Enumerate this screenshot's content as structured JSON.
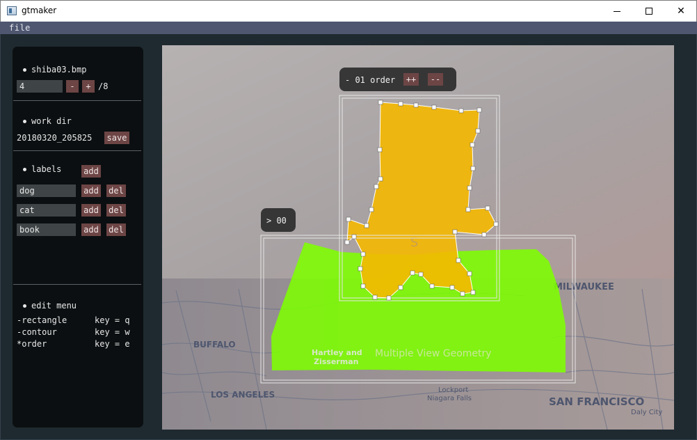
{
  "window": {
    "title": "gtmaker"
  },
  "menu": {
    "file": "file"
  },
  "panel": {
    "image": {
      "filename": "shiba03.bmp",
      "index": "4",
      "minus": "-",
      "plus": "+",
      "total": "/8"
    },
    "workdir": {
      "heading": "work dir",
      "value": "20180320_205825",
      "save": "save"
    },
    "labels": {
      "heading": "labels",
      "add": "add",
      "items": [
        {
          "name": "dog",
          "add": "add",
          "del": "del"
        },
        {
          "name": "cat",
          "add": "add",
          "del": "del"
        },
        {
          "name": "book",
          "add": "add",
          "del": "del"
        }
      ]
    },
    "edit_menu": {
      "heading": "edit menu",
      "items": [
        {
          "action": "-rectangle",
          "key": "key = q"
        },
        {
          "action": "-contour",
          "key": "key = w"
        },
        {
          "action": "*order",
          "key": "key = e"
        }
      ]
    }
  },
  "canvas": {
    "order_tag": {
      "label": "- 01 order",
      "inc": "++",
      "dec": "--"
    },
    "item_tag": {
      "label": "> 00"
    },
    "photo_text": {
      "book_authors_1": "Hartley and",
      "book_authors_2": "Zisserman",
      "book_title": "Multiple View Geometry",
      "map_milwaukee": "MILWAUKEE",
      "map_buffalo": "BUFFALO",
      "map_san_francisco": "SAN FRANCISCO",
      "map_los_angeles": "LOS ANGELES",
      "map_niagara": "Niagara Falls",
      "map_lockport": "Lockport",
      "map_daly": "Daly City",
      "toy_letter": "S"
    },
    "colors": {
      "dog_mask": "#f5b800",
      "book_mask": "#7dff00",
      "vertex": "#ffffff"
    }
  }
}
